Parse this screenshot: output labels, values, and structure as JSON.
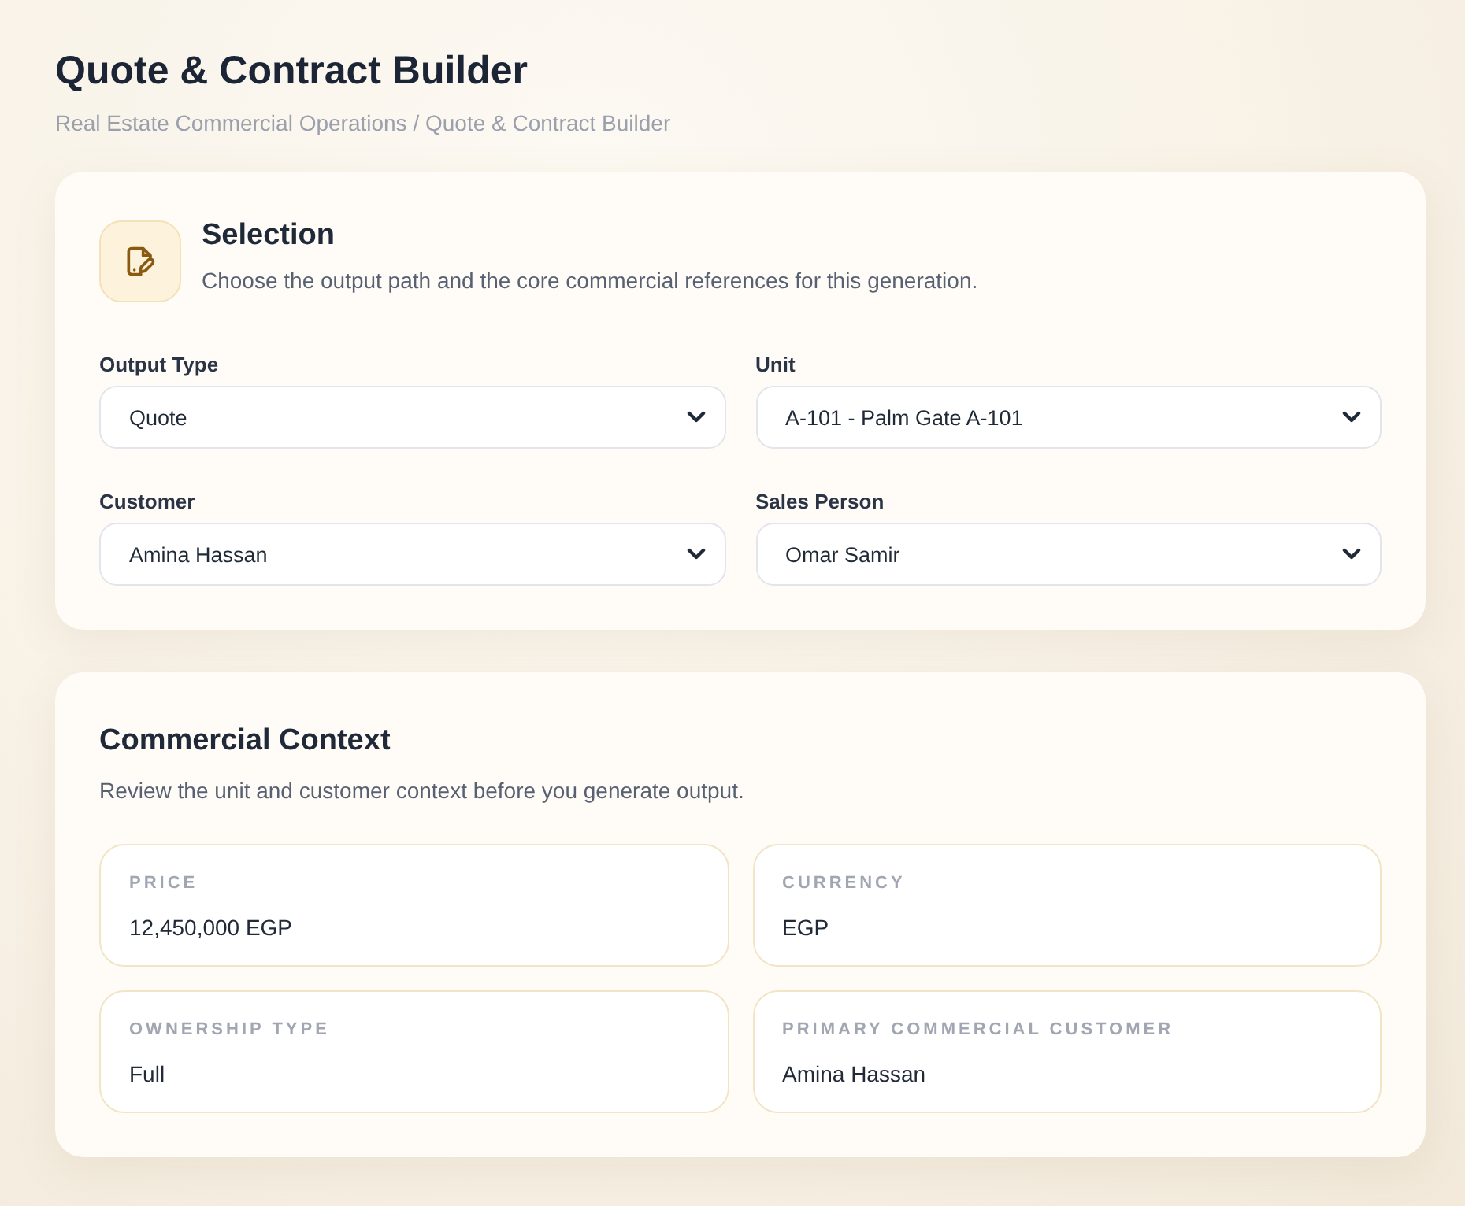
{
  "page": {
    "title": "Quote & Contract Builder",
    "breadcrumb": "Real Estate Commercial Operations / Quote & Contract Builder"
  },
  "selection": {
    "title": "Selection",
    "description": "Choose the output path and the core commercial references for this generation.",
    "fields": [
      {
        "label": "Output Type",
        "value": "Quote"
      },
      {
        "label": "Unit",
        "value": "A-101 - Palm Gate A-101"
      },
      {
        "label": "Customer",
        "value": "Amina Hassan"
      },
      {
        "label": "Sales Person",
        "value": "Omar Samir"
      }
    ]
  },
  "commercial_context": {
    "title": "Commercial Context",
    "description": "Review the unit and customer context before you generate output.",
    "items": [
      {
        "label": "PRICE",
        "value": "12,450,000 EGP"
      },
      {
        "label": "CURRENCY",
        "value": "EGP"
      },
      {
        "label": "OWNERSHIP TYPE",
        "value": "Full"
      },
      {
        "label": "PRIMARY COMMERCIAL CUSTOMER",
        "value": "Amina Hassan"
      }
    ]
  }
}
